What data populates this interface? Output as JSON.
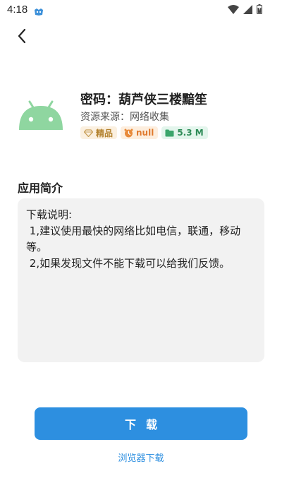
{
  "status_bar": {
    "time": "4:18",
    "icons": [
      "app-notification-icon",
      "wifi-icon",
      "signal-icon",
      "battery-icon"
    ]
  },
  "header": {
    "back_icon": "chevron-left-icon"
  },
  "app": {
    "icon": "android-icon",
    "icon_color": "#8fd6a0",
    "title": "密码：葫芦侠三楼黯笙",
    "source": "资源来源：网络收集",
    "badges": {
      "quality": {
        "label": "精品",
        "icon": "diamond-icon",
        "color": "#b3822f"
      },
      "version": {
        "label": "null",
        "icon": "clock-icon",
        "color": "#e07a2e"
      },
      "size": {
        "label": "5.3 M",
        "icon": "folder-icon",
        "color": "#2e8b57"
      }
    }
  },
  "intro": {
    "title": "应用简介",
    "description": "下载说明:\n 1,建议使用最快的网络比如电信，联通，移动等。\n 2,如果发现文件不能下载可以给我们反馈。"
  },
  "actions": {
    "download_label": "下载",
    "browser_download_label": "浏览器下载",
    "accent_color": "#2d8fe0"
  }
}
